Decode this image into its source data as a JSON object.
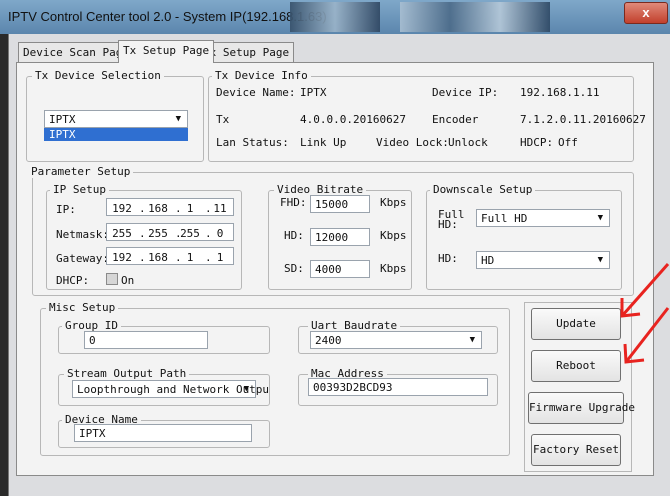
{
  "window": {
    "title": "IPTV Control Center tool 2.0 - System IP(192.168.1.63)",
    "close_label": "x"
  },
  "tabs": [
    {
      "label": "Device Scan Page"
    },
    {
      "label": "Tx Setup Page"
    },
    {
      "label": "Rx Setup Page"
    }
  ],
  "tx_selection": {
    "legend": "Tx Device Selection",
    "selected": "IPTX",
    "dropdown_item": "IPTX"
  },
  "device_info": {
    "legend": "Tx Device Info",
    "device_name_label": "Device Name:",
    "device_name": "IPTX",
    "device_ip_label": "Device IP:",
    "device_ip": "192.168.1.11",
    "tx_label": "Tx",
    "tx_version": "4.0.0.0.20160627",
    "encoder_label": "Encoder",
    "encoder_version": "7.1.2.0.11.20160627",
    "lan_status_label": "Lan Status:",
    "lan_status": "Link Up",
    "video_lock_label": "Video Lock:",
    "video_lock": "Unlock",
    "hdcp_label": "HDCP:",
    "hdcp": "Off"
  },
  "parameter_setup": {
    "legend": "Parameter Setup",
    "ip_setup": {
      "legend": "IP Setup",
      "ip_label": "IP:",
      "ip": [
        "192",
        "168",
        "1",
        "11"
      ],
      "netmask_label": "Netmask:",
      "netmask": [
        "255",
        "255",
        "255",
        "0"
      ],
      "gateway_label": "Gateway:",
      "gateway": [
        "192",
        "168",
        "1",
        "1"
      ],
      "dhcp_label": "DHCP:",
      "dhcp_option": "On",
      "dot": "."
    },
    "video_bitrate": {
      "legend": "Video Bitrate",
      "fhd_label": "FHD:",
      "fhd_value": "15000",
      "hd_label": "HD:",
      "hd_value": "12000",
      "sd_label": "SD:",
      "sd_value": "4000",
      "unit": "Kbps"
    },
    "downscale": {
      "legend": "Downscale Setup",
      "full_label_line1": "Full",
      "full_label_line2": "HD:",
      "full_value": "Full HD",
      "hd_label": "HD:",
      "hd_value": "HD"
    }
  },
  "misc_setup": {
    "legend": "Misc Setup",
    "group_id_legend": "Group ID",
    "group_id": "0",
    "uart_legend": "Uart Baudrate",
    "uart_value": "2400",
    "stream_legend": "Stream Output Path",
    "stream_value": "Loopthrough and Network Outpu",
    "mac_legend": "Mac Address",
    "mac_value": "00393D2BCD93",
    "device_name_legend": "Device Name",
    "device_name_value": "IPTX"
  },
  "buttons": {
    "update": "Update",
    "reboot": "Reboot",
    "firmware": "Firmware Upgrade",
    "factory": "Factory Reset"
  },
  "colors": {
    "annotation_arrow": "#e8231f",
    "titlebar": "#6d96bb",
    "close": "#c94a35"
  }
}
